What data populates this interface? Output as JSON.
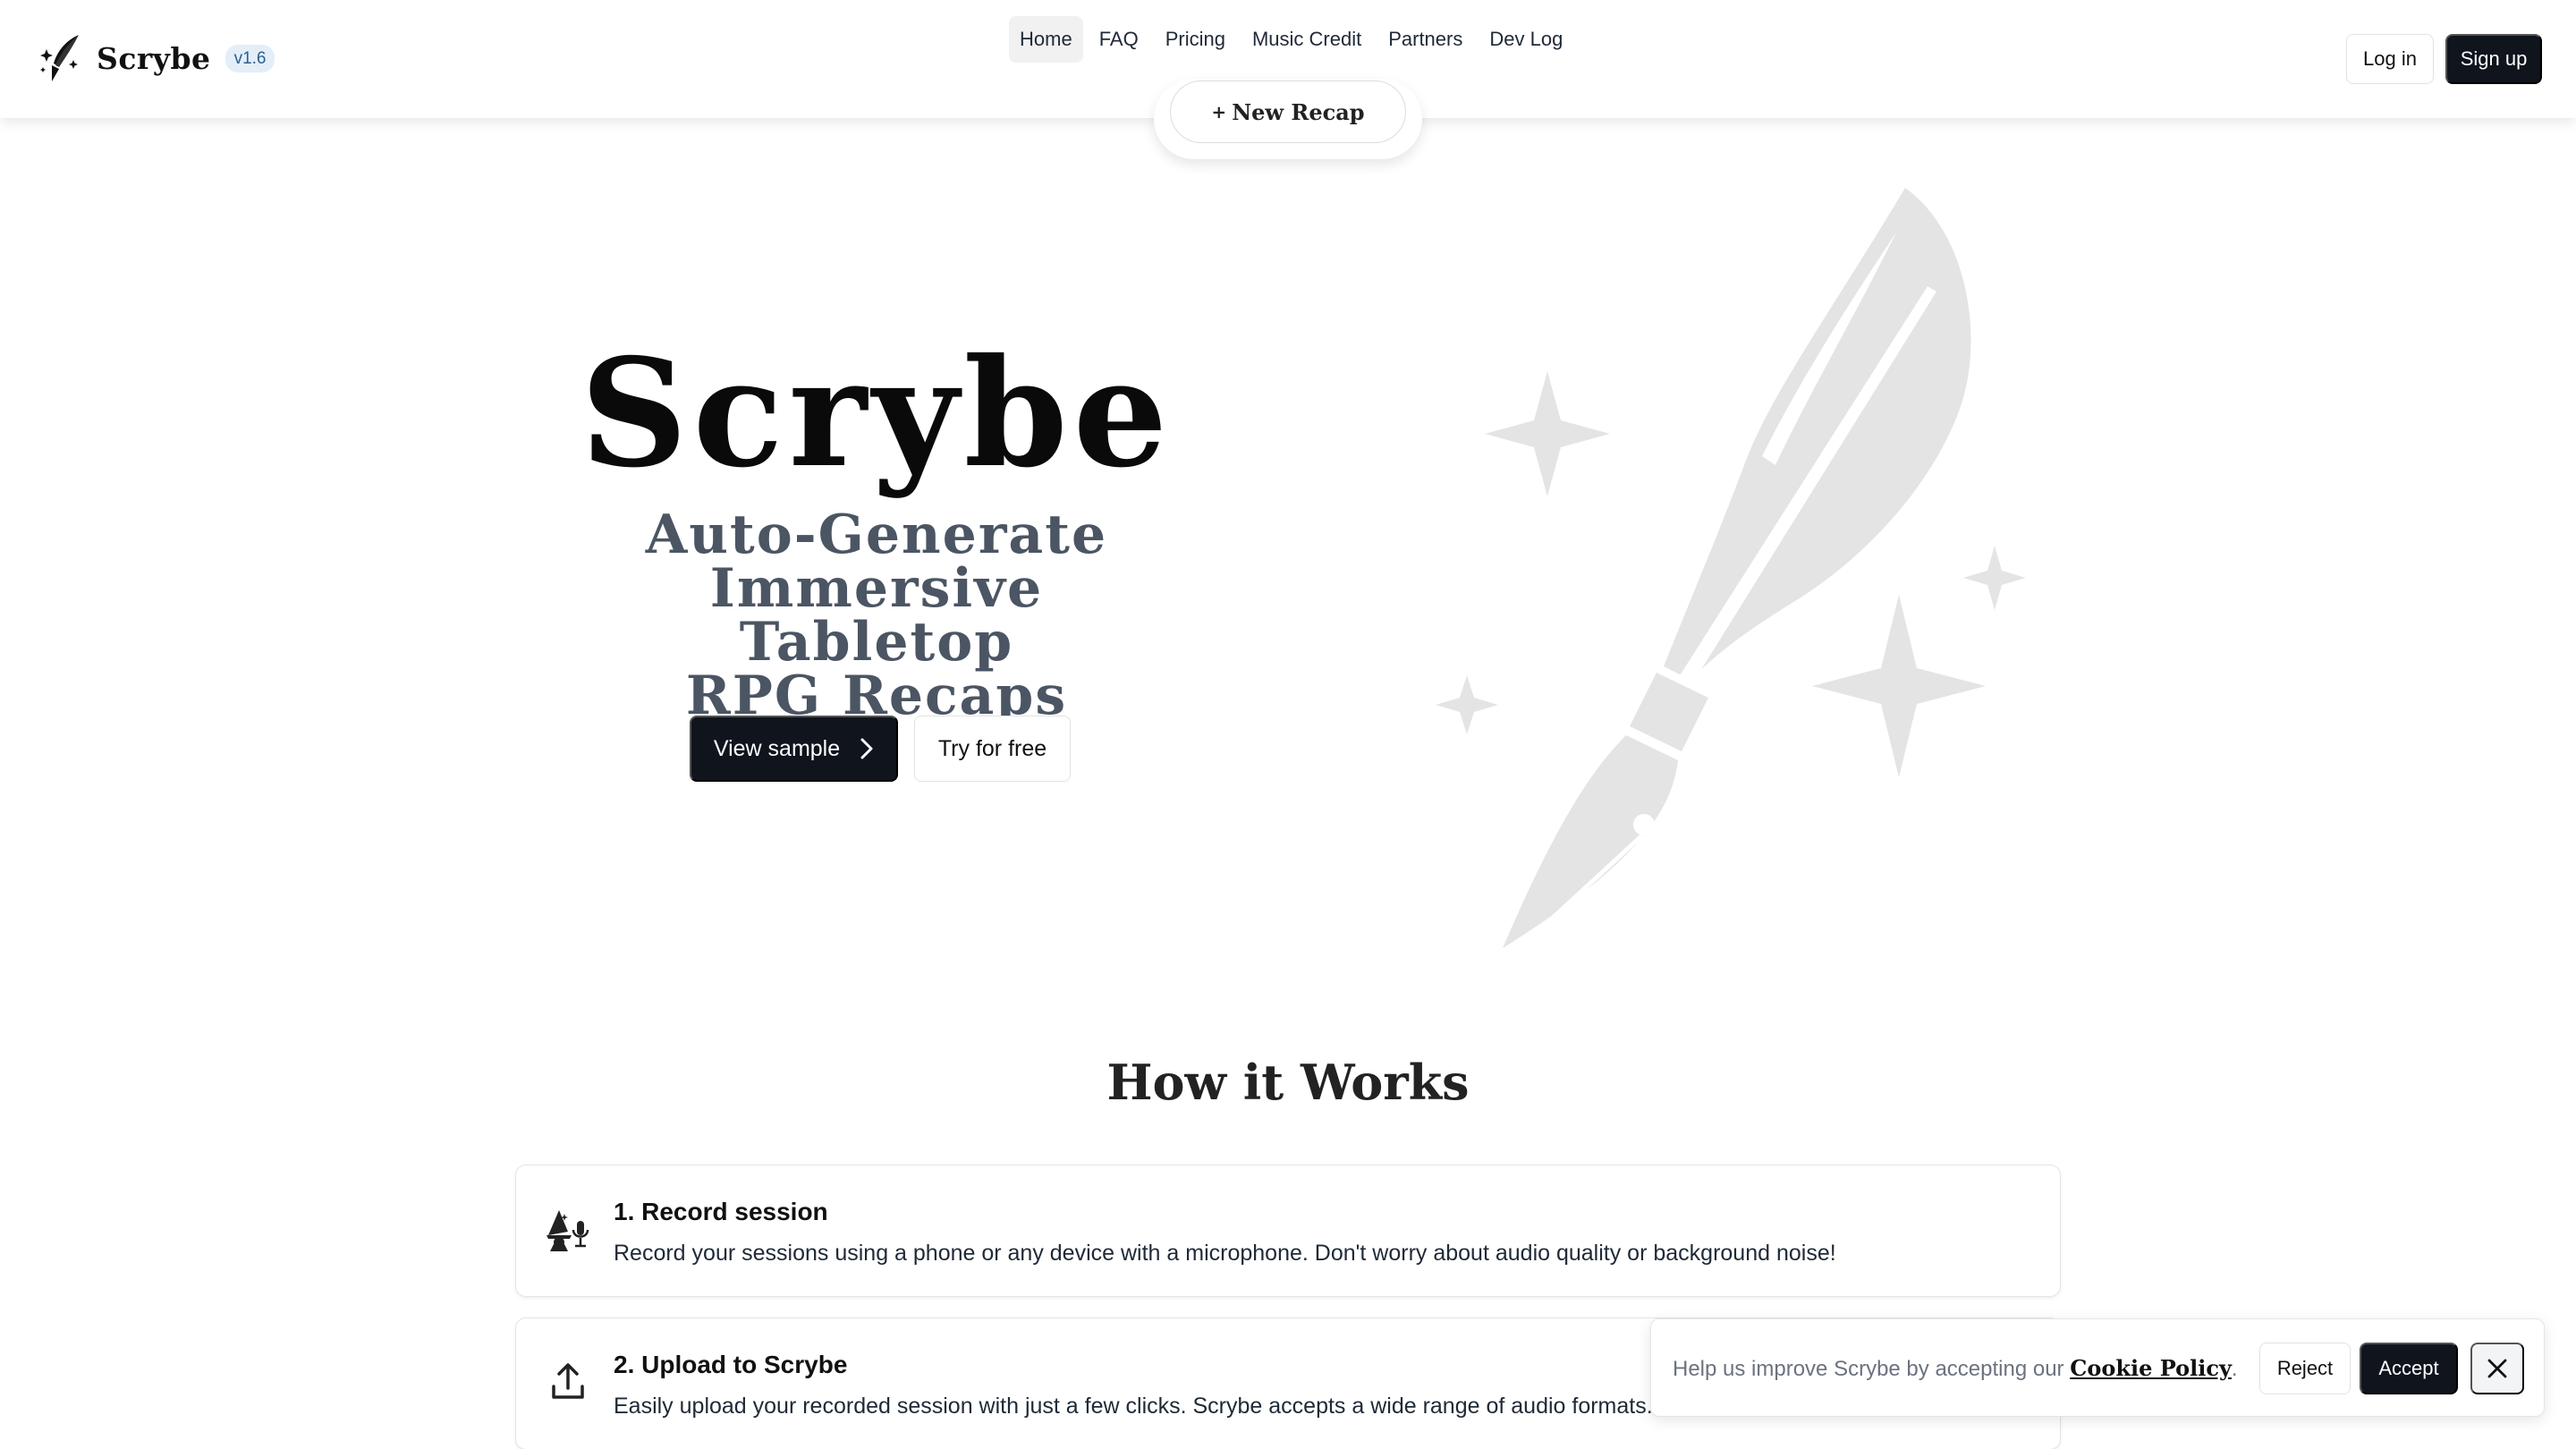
{
  "header": {
    "brand_name": "Scrybe",
    "version": "v1.6",
    "nav": [
      {
        "label": "Home",
        "active": true
      },
      {
        "label": "FAQ"
      },
      {
        "label": "Pricing"
      },
      {
        "label": "Music Credit"
      },
      {
        "label": "Partners"
      },
      {
        "label": "Dev Log"
      }
    ],
    "login_label": "Log in",
    "signup_label": "Sign up",
    "new_recap_label": "New Recap"
  },
  "hero": {
    "title": "Scrybe",
    "subtitle_lines": [
      "Auto-Generate",
      "Immersive Tabletop",
      "RPG Recaps"
    ],
    "view_sample_label": "View sample",
    "try_free_label": "Try for free",
    "art_icon": "quill-pen-sparkles-icon"
  },
  "how": {
    "title": "How it Works",
    "steps": [
      {
        "title": "1. Record session",
        "description": "Record your sessions using a phone or any device with a microphone. Don't worry about audio quality or background noise!",
        "icon": "wizard-microphone-icon"
      },
      {
        "title": "2. Upload to Scrybe",
        "description": "Easily upload your recorded session with just a few clicks. Scrybe accepts a wide range of audio formats.",
        "icon": "upload-icon"
      }
    ]
  },
  "cookie": {
    "text_before": "Help us improve Scrybe by accepting our ",
    "link_label": "Cookie Policy",
    "text_after": ".",
    "reject_label": "Reject",
    "accept_label": "Accept"
  },
  "colors": {
    "primary_dark": "#0f141d",
    "badge_bg": "#e3eef9",
    "hero_art": "#e6e6e6",
    "subtitle": "#4b5563"
  }
}
